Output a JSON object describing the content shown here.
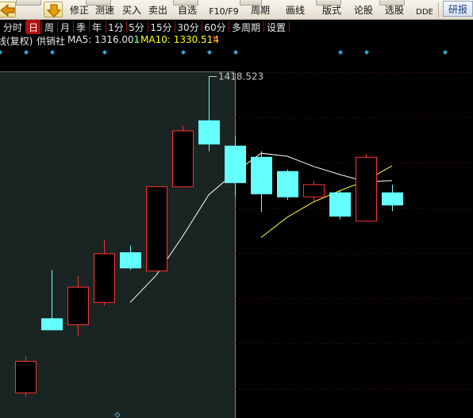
{
  "toolbar": {
    "items": [
      "修正",
      "测速",
      "买入",
      "卖出",
      "自选",
      "F10/F9",
      "周期",
      "画线",
      "版式",
      "论股",
      "选股",
      "DDE"
    ],
    "research_label": "研报",
    "back_icon": "back-arrow-icon",
    "down_icon": "down-arrow-icon"
  },
  "period_bar": {
    "items": [
      "分时",
      "日",
      "周",
      "月",
      "季",
      "年",
      "1分",
      "5分",
      "15分",
      "30分",
      "60分",
      "多周期",
      "设置"
    ],
    "active": "日"
  },
  "info": {
    "title_prefix": "线(复权)",
    "stock_name": "供销社",
    "ma5_label": "MA5: 1316.001",
    "ma5_arrow": "↓",
    "ma10_label": "MA10: 1330.514",
    "ma10_arrow": "↑",
    "ma5_color": "#ffffff",
    "ma10_color": "#ffff00",
    "down_arrow_color": "#00d000",
    "up_arrow_color": "#ff3030"
  },
  "chart_data": {
    "type": "candlestick",
    "max_label": "1418.523",
    "price_range": [
      1090,
      1440
    ],
    "up_color": "#ff3333",
    "down_color": "#66ffff",
    "candles": [
      {
        "open": 1107,
        "close": 1138,
        "high": 1143,
        "low": 1103
      },
      {
        "open": 1180,
        "close": 1169,
        "high": 1228,
        "low": 1169
      },
      {
        "open": 1174,
        "close": 1211,
        "high": 1222,
        "low": 1163
      },
      {
        "open": 1196,
        "close": 1244,
        "high": 1258,
        "low": 1193
      },
      {
        "open": 1245,
        "close": 1230,
        "high": 1252,
        "low": 1228
      },
      {
        "open": 1227,
        "close": 1310,
        "high": 1310,
        "low": 1227
      },
      {
        "open": 1310,
        "close": 1365,
        "high": 1370,
        "low": 1310
      },
      {
        "open": 1375,
        "close": 1352,
        "high": 1418.523,
        "low": 1345
      },
      {
        "open": 1350,
        "close": 1314,
        "high": 1360,
        "low": 1300
      },
      {
        "open": 1339,
        "close": 1303,
        "high": 1345,
        "low": 1285
      },
      {
        "open": 1325,
        "close": 1300,
        "high": 1327,
        "low": 1297
      },
      {
        "open": 1300,
        "close": 1312,
        "high": 1316,
        "low": 1296
      },
      {
        "open": 1304,
        "close": 1281,
        "high": 1306,
        "low": 1278
      },
      {
        "open": 1276,
        "close": 1339,
        "high": 1342,
        "low": 1276
      },
      {
        "open": 1304,
        "close": 1292,
        "high": 1312,
        "low": 1286
      }
    ],
    "ma5": [
      null,
      null,
      null,
      null,
      1196,
      1223,
      1261,
      1302,
      1324,
      1343,
      1340,
      1330,
      1322,
      1315,
      1316
    ],
    "ma10": [
      null,
      null,
      null,
      null,
      null,
      null,
      null,
      null,
      null,
      1260,
      1280,
      1295,
      1306,
      1316,
      1330.514
    ]
  }
}
